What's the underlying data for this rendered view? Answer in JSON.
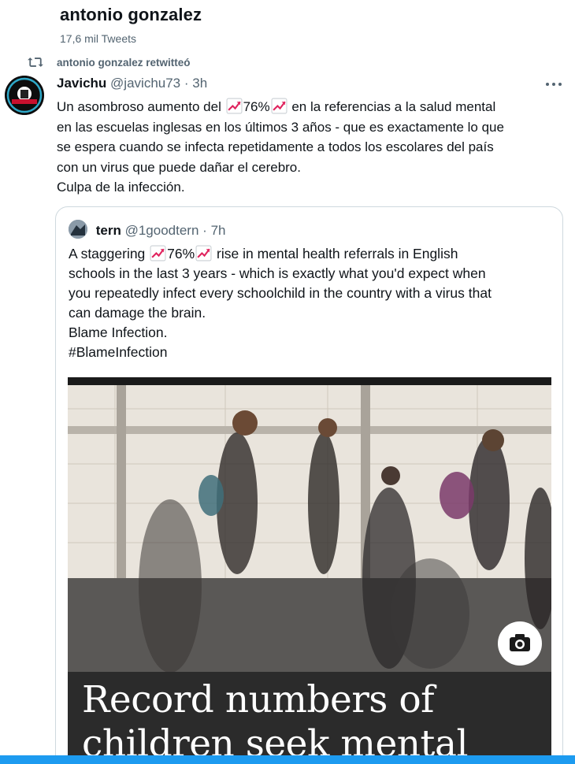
{
  "profile": {
    "name": "antonio gonzalez",
    "tweet_count": "17,6 mil Tweets"
  },
  "retweet": {
    "label": "antonio gonzalez retwitteó",
    "icon": "retweet-icon"
  },
  "tweet": {
    "author_name": "Javichu",
    "handle": "@javichu73",
    "separator": "·",
    "time": "3h",
    "more_icon": "more-icon",
    "emoji": "chart-increasing-emoji",
    "line1_before": "Un asombroso aumento del ",
    "line1_value": "76%",
    "line1_after": " en la referencias a la salud mental",
    "line2": "en las escuelas inglesas en los últimos 3 años - que es exactamente lo que",
    "line3": "se espera cuando se infecta repetidamente a todos los escolares del país",
    "line4": "con un virus que puede dañar el cerebro.",
    "line5": "Culpa de la infección."
  },
  "quote": {
    "author_name": "tern",
    "handle": "@1goodtern",
    "separator": "·",
    "time": "7h",
    "line1_before": "A staggering ",
    "line1_value": "76%",
    "line1_after": " rise in mental health referrals in English",
    "line2": "schools in the last 3 years - which is exactly what you'd expect when",
    "line3": "you repeatedly infect every schoolchild in the country with a virus that",
    "line4": "can damage the brain.",
    "line5": "Blame Infection.",
    "line6": "#BlameInfection",
    "media_caption_line1": "Record numbers of",
    "media_caption_line2": "children seek mental",
    "media_icon": "camera-icon"
  },
  "colors": {
    "accent": "#1d9bf0",
    "secondary_text": "#536471",
    "border": "#cfd9de"
  }
}
